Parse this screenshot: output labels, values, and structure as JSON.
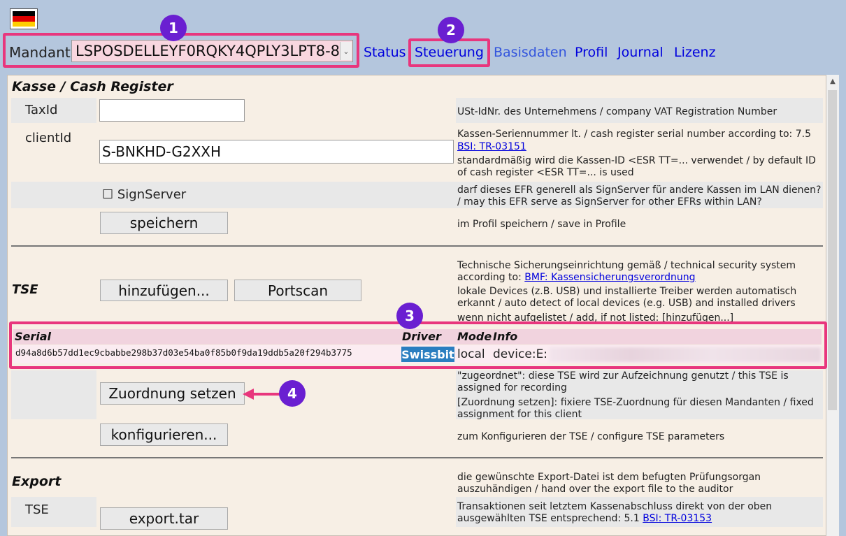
{
  "header": {
    "mandant_label": "Mandant",
    "mandant_value": "LSPOSDELLEYF0RQKY4QPLY3LPT8-8",
    "nav": [
      "Status",
      "Steuerung",
      "Basisdaten",
      "Profil",
      "Journal",
      "Lizenz"
    ]
  },
  "badges": [
    "1",
    "2",
    "3",
    "4"
  ],
  "kasse": {
    "title": "Kasse / Cash Register",
    "taxid_label": "TaxId",
    "taxid_value": "",
    "taxid_desc": "USt-IdNr. des Unternehmens / company VAT Registration Number",
    "clientid_label": "clientId",
    "clientid_value": "S-BNKHD-G2XXH",
    "clientid_desc1": "Kassen-Seriennummer lt. / cash register serial number according to: 7.5",
    "clientid_link": "BSI: TR-03151",
    "clientid_desc2a": "standardmäßig wird die Kassen-ID <ESR TT=... verwendet / by default ID",
    "clientid_desc2b": "of cash register <ESR TT=... is used",
    "signserver_label": "SignServer",
    "signserver_desc1": "darf dieses EFR generell als SignServer für andere Kassen im LAN dienen?",
    "signserver_desc2": "/ may this EFR serve as SignServer for other EFRs within LAN?",
    "save_button": "speichern",
    "save_desc": "im Profil speichern / save in Profile"
  },
  "tse": {
    "title": "TSE",
    "desc1": "Technische Sicherungseinrichtung gemäß / technical security system",
    "desc2_prefix": "according to: ",
    "desc2_link": "BMF: Kassensicherungsverordnung",
    "desc3": "lokale Devices (z.B. USB) und installierte Treiber werden automatisch",
    "desc4": "erkannt / auto detect of local devices (e.g. USB) and installed drivers",
    "desc5": "wenn nicht aufgelistet / add, if not listed: [hinzufügen...]",
    "add_button": "hinzufügen...",
    "portscan_button": "Portscan",
    "table": {
      "headers": [
        "Serial",
        "Driver",
        "Mode",
        "Info"
      ],
      "row": {
        "serial": "d94a8d6b57dd1ec9cbabbe298b37d03e54ba0f85b0f9da19ddb5a20f294b3775",
        "driver": "Swissbit",
        "mode": "local",
        "info": "device:E:"
      }
    },
    "assign_button": "Zuordnung setzen",
    "assign_desc1": "\"zugeordnet\": diese TSE wird zur Aufzeichnung genutzt / this TSE is",
    "assign_desc2": "assigned for recording",
    "assign_desc3": "[Zuordnung setzen]: fixiere TSE-Zuordnung für diesen Mandanten / fixed",
    "assign_desc4": "assignment for this client",
    "configure_button": "konfigurieren...",
    "configure_desc": "zum Konfigurieren der TSE / configure TSE parameters"
  },
  "export": {
    "title": "Export",
    "desc1": "die gewünschte Export-Datei ist dem befugten Prüfungsorgan",
    "desc2": "auszuhändigen / hand over the export file to the auditor",
    "tse_label": "TSE",
    "tar_button": "export.tar",
    "tar_desc1": "Transaktionen seit letztem Kassenabschluss direkt von der oben",
    "tar_desc2_prefix": "ausgewählten TSE entsprechend: 5.1 ",
    "tar_desc2_link": "BSI: TR-03153"
  },
  "colors": {
    "highlight": "#e8367d",
    "badge": "#6a1fd1",
    "link": "#0000dd",
    "driver_badge": "#2a7ec0"
  }
}
